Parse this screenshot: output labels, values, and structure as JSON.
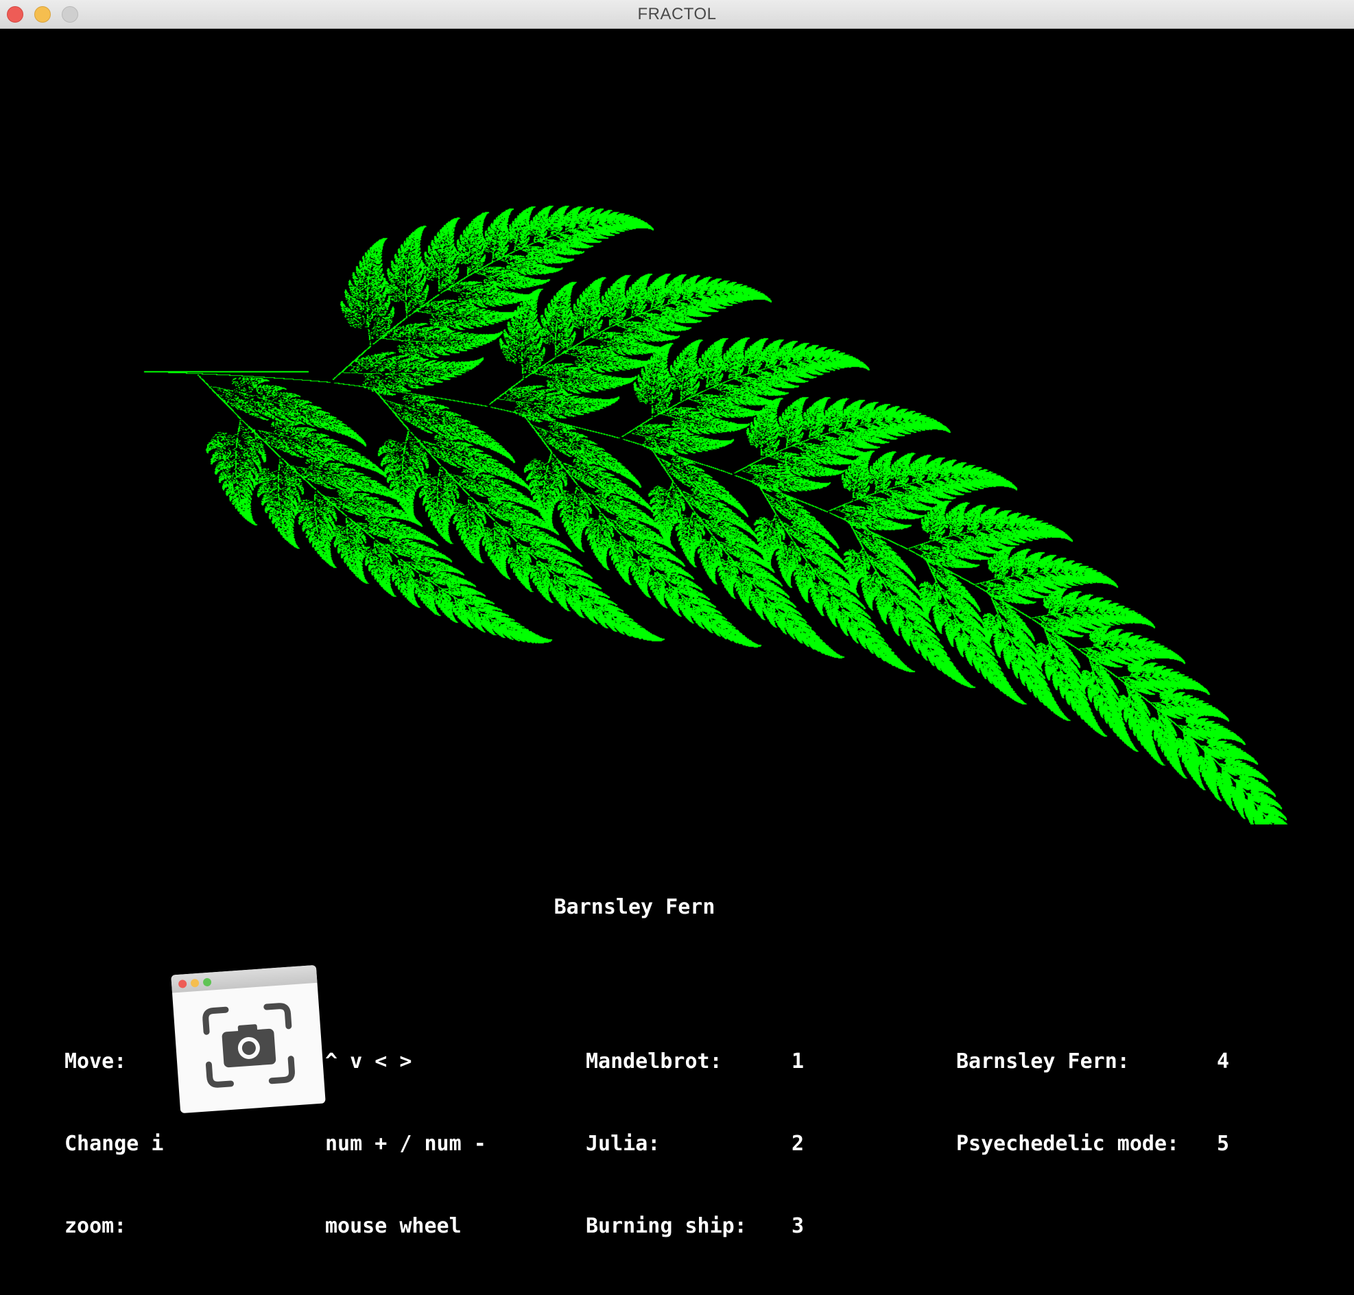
{
  "window": {
    "title": "FRACTOL"
  },
  "fractal": {
    "name": "Barnsley Fern",
    "color": "#00ff00",
    "background": "#000000"
  },
  "controls": {
    "move_label": "Move:",
    "move_value": "^ v < >",
    "iter_label": "Change i",
    "iter_value": "num + / num -",
    "zoom_label": "zoom:",
    "zoom_value": "mouse wheel"
  },
  "fractal_keys": [
    {
      "label": "Mandelbrot:",
      "key": "1"
    },
    {
      "label": "Julia:",
      "key": "2"
    },
    {
      "label": "Burning ship:",
      "key": "3"
    },
    {
      "label": "Barnsley Fern:",
      "key": "4"
    },
    {
      "label": "Psyechedelic mode:",
      "key": "5"
    }
  ],
  "overlay": {
    "icon": "screenshot-camera-icon"
  }
}
